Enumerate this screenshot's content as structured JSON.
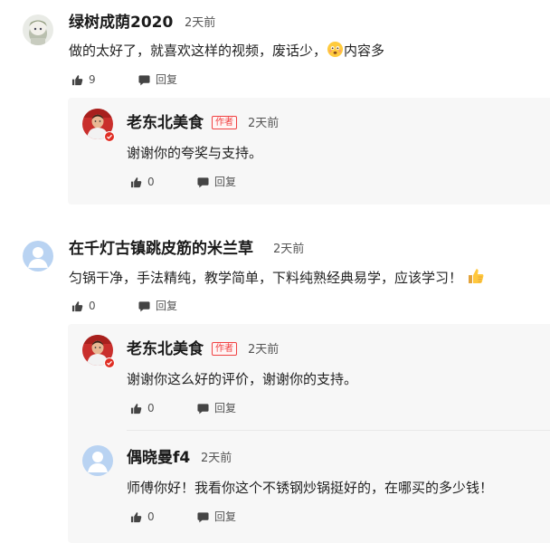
{
  "comments": [
    {
      "user": "绿树成荫2020",
      "time": "2天前",
      "text": "做的太好了，就喜欢这样的视频，废话少，",
      "text_tail": "内容多",
      "emoji": "flushed-face-emoji",
      "likes": "9",
      "reply_label": "回复",
      "replies": [
        {
          "user": "老东北美食",
          "tag": "作者",
          "time": "2天前",
          "text": "谢谢你的夸奖与支持。",
          "likes": "0",
          "reply_label": "回复"
        }
      ]
    },
    {
      "user": "在千灯古镇跳皮筋的米兰草",
      "time": "2天前",
      "text": "匀锅干净，手法精纯，教学简单，下料纯熟经典易学，应该学习！",
      "emoji": "thumbs-up-emoji",
      "likes": "0",
      "reply_label": "回复",
      "replies": [
        {
          "user": "老东北美食",
          "tag": "作者",
          "time": "2天前",
          "text": "谢谢你这么好的评价，谢谢你的支持。",
          "likes": "0",
          "reply_label": "回复"
        },
        {
          "user": "偶晓曼f4",
          "time": "2天前",
          "text": "师傅你好！我看你这个不锈钢炒锅挺好的，在哪买的多少钱！",
          "likes": "0",
          "reply_label": "回复"
        }
      ]
    }
  ],
  "colors": {
    "author_tag": "#f04142",
    "verified_badge": "#e02e24",
    "reply_background": "#f7f7f7",
    "default_avatar": "#b9d3f2"
  }
}
